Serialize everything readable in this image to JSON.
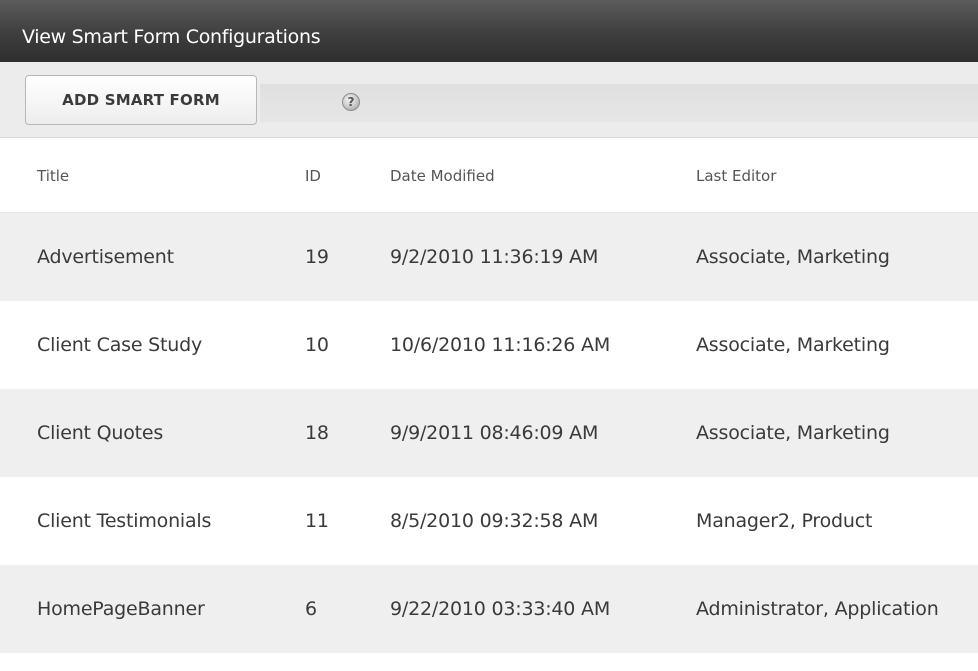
{
  "window": {
    "title": "View Smart Form Configurations"
  },
  "toolbar": {
    "add_button_label": "ADD SMART FORM",
    "help_icon_glyph": "?"
  },
  "table": {
    "columns": [
      "Title",
      "ID",
      "Date Modified",
      "Last Editor"
    ],
    "rows": [
      {
        "title": "Advertisement",
        "id": "19",
        "date_modified": "9/2/2010 11:36:19 AM",
        "last_editor": "Associate, Marketing"
      },
      {
        "title": "Client Case Study",
        "id": "10",
        "date_modified": "10/6/2010 11:16:26 AM",
        "last_editor": "Associate, Marketing"
      },
      {
        "title": "Client Quotes",
        "id": "18",
        "date_modified": "9/9/2011 08:46:09 AM",
        "last_editor": "Associate, Marketing"
      },
      {
        "title": "Client Testimonials",
        "id": "11",
        "date_modified": "8/5/2010 09:32:58 AM",
        "last_editor": "Manager2, Product"
      },
      {
        "title": "HomePageBanner",
        "id": "6",
        "date_modified": "9/22/2010 03:33:40 AM",
        "last_editor": "Administrator, Application"
      }
    ]
  },
  "colors": {
    "titlebar": "#3e3e3e",
    "toolbar": "#ececec",
    "row_shade": "#efefef",
    "text": "#3a3a3a"
  }
}
